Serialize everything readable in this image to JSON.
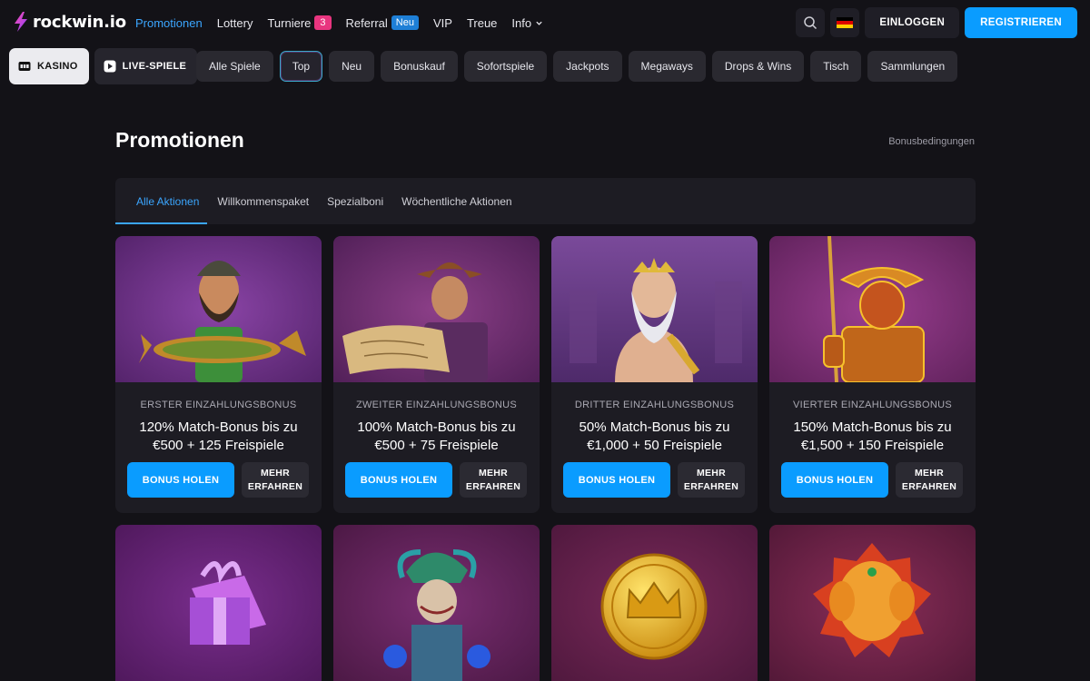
{
  "header": {
    "logo_text": "rockwin.io",
    "nav": [
      {
        "label": "Promotionen",
        "active": true
      },
      {
        "label": "Lottery"
      },
      {
        "label": "Turniere",
        "badge": "3"
      },
      {
        "label": "Referral",
        "badge": "Neu"
      },
      {
        "label": "VIP"
      },
      {
        "label": "Treue"
      },
      {
        "label": "Info"
      }
    ],
    "login_label": "EINLOGGEN",
    "register_label": "REGISTRIEREN",
    "language_flag": "de-flag-icon"
  },
  "modes": [
    {
      "label": "KASINO",
      "icon": "slot-machine-icon",
      "active": true
    },
    {
      "label": "LIVE-SPIELE",
      "icon": "play-icon",
      "active": false
    }
  ],
  "categories": [
    "Alle Spiele",
    "Top",
    "Neu",
    "Bonuskauf",
    "Sofortspiele",
    "Jackpots",
    "Megaways",
    "Drops & Wins",
    "Tisch",
    "Sammlungen"
  ],
  "page": {
    "title": "Promotionen",
    "terms_link": "Bonusbedingungen",
    "tabs": [
      "Alle Aktionen",
      "Willkommenspaket",
      "Spezialboni",
      "Wöchentliche Aktionen"
    ]
  },
  "promotions": [
    {
      "label": "ERSTER EINZAHLUNGSBONUS",
      "title": "120% Match-Bonus bis zu €500 + 125 Freispiele",
      "art": "fisherman-with-fish"
    },
    {
      "label": "ZWEITER EINZAHLUNGSBONUS",
      "title": "100% Match-Bonus bis zu €500 + 75 Freispiele",
      "art": "explorer-with-map"
    },
    {
      "label": "DRITTER EINZAHLUNGSBONUS",
      "title": "50% Match-Bonus bis zu €1,000 + 50 Freispiele",
      "art": "zeus"
    },
    {
      "label": "VIERTER EINZAHLUNGSBONUS",
      "title": "150% Match-Bonus bis zu €1,500 + 150 Freispiele",
      "art": "golden-fisherman"
    }
  ],
  "promotions_row2": [
    {
      "art": "gift-box"
    },
    {
      "art": "jester"
    },
    {
      "art": "gold-crown-coin"
    },
    {
      "art": "golden-elephant"
    }
  ],
  "card_buttons": {
    "bonus": "BONUS HOLEN",
    "more": "MEHR\nERFAHREN"
  },
  "colors": {
    "background": "#131217",
    "surface": "#1d1c23",
    "accent_blue": "#0a9cff",
    "active_link": "#3ba6ff",
    "badge_pink": "#e8357f"
  }
}
